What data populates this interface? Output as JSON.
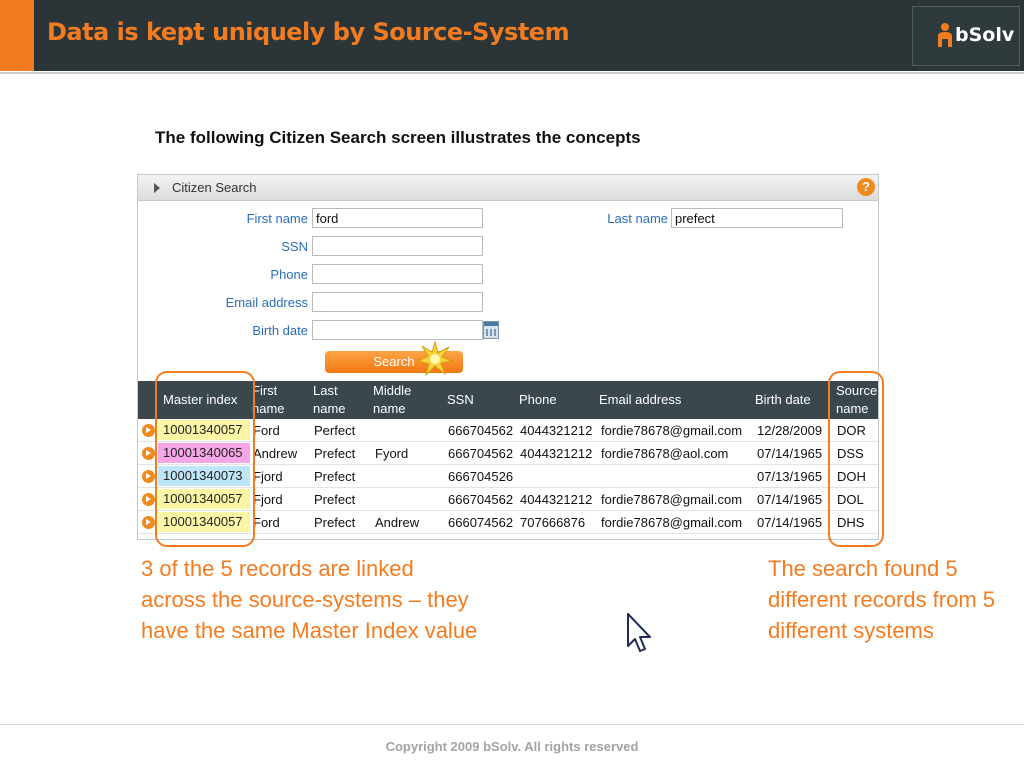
{
  "header": {
    "title": "Data is kept uniquely by Source-System",
    "logo_text": "bSolv",
    "colors": {
      "bar": "#2b3538",
      "accent": "#f47c20"
    }
  },
  "subtitle": "The following Citizen Search screen illustrates the concepts",
  "panel": {
    "title": "Citizen Search",
    "help_icon": "help-icon",
    "fields": {
      "first_name": {
        "label": "First name",
        "value": "ford"
      },
      "last_name": {
        "label": "Last name",
        "value": "prefect"
      },
      "ssn": {
        "label": "SSN",
        "value": ""
      },
      "phone": {
        "label": "Phone",
        "value": ""
      },
      "email": {
        "label": "Email address",
        "value": ""
      },
      "birth_date": {
        "label": "Birth date",
        "value": ""
      }
    },
    "search_label": "Search"
  },
  "results": {
    "columns": {
      "master": [
        "Master index"
      ],
      "first": [
        "First",
        "name"
      ],
      "last": [
        "Last",
        "name"
      ],
      "middle": [
        "Middle",
        "name"
      ],
      "ssn": [
        "SSN"
      ],
      "phone": [
        "Phone"
      ],
      "email": [
        "Email address"
      ],
      "birth": [
        "Birth date"
      ],
      "source": [
        "Source",
        "name"
      ]
    },
    "rows": [
      {
        "master": "10001340057",
        "first": "Ford",
        "last": "Perfect",
        "middle": "",
        "ssn": "666704562",
        "phone": "4044321212",
        "email": "fordie78678@gmail.com",
        "birth": "12/28/2009",
        "source": "DOR",
        "highlight": "#fbf6a6"
      },
      {
        "master": "10001340065",
        "first": "Andrew",
        "last": "Prefect",
        "middle": "Fyord",
        "ssn": "666704562",
        "phone": "4044321212",
        "email": "fordie78678@aol.com",
        "birth": "07/14/1965",
        "source": "DSS",
        "highlight": "#f5a6e6"
      },
      {
        "master": "10001340073",
        "first": "Fjord",
        "last": "Prefect",
        "middle": "",
        "ssn": "666704526",
        "phone": "",
        "email": "",
        "birth": "07/13/1965",
        "source": "DOH",
        "highlight": "#bfe6f8"
      },
      {
        "master": "10001340057",
        "first": "Fjord",
        "last": "Prefect",
        "middle": "",
        "ssn": "666704562",
        "phone": "4044321212",
        "email": "fordie78678@gmail.com",
        "birth": "07/14/1965",
        "source": "DOL",
        "highlight": "#fbf6a6"
      },
      {
        "master": "10001340057",
        "first": "Ford",
        "last": "Prefect",
        "middle": "Andrew",
        "ssn": "666074562",
        "phone": "707666876",
        "email": "fordie78678@gmail.com",
        "birth": "07/14/1965",
        "source": "DHS",
        "highlight": "#fbf6a6"
      }
    ]
  },
  "notes": {
    "left": "3 of the 5 records are linked across the source-systems – they have the same Master Index value",
    "right": "The search found 5 different records from 5 different systems"
  },
  "footer": "Copyright 2009 bSolv. All rights reserved"
}
